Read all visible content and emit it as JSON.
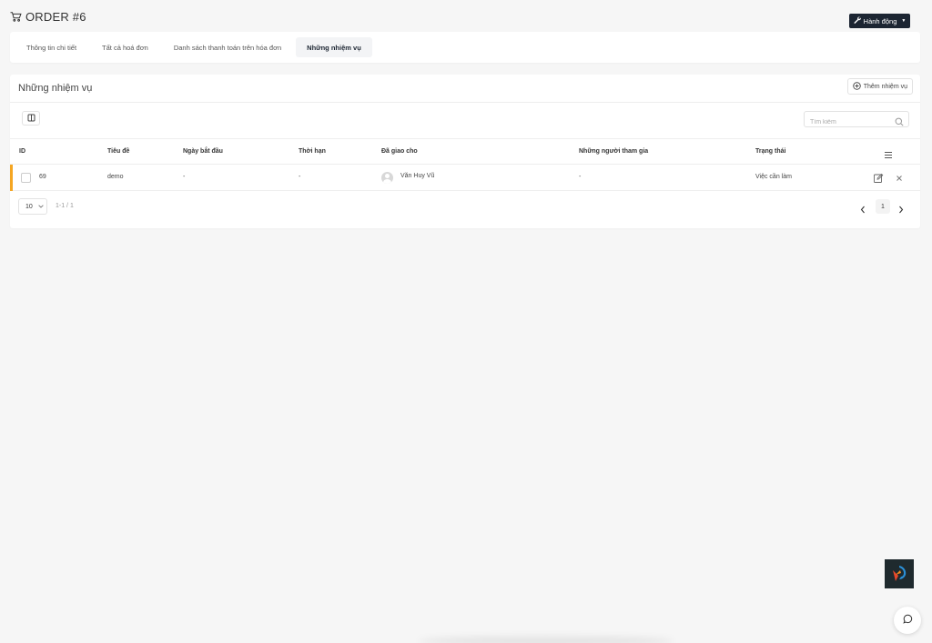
{
  "header": {
    "title": "ORDER #6",
    "icon": "cart-icon"
  },
  "action_button": {
    "label": "Hành động",
    "icon": "wrench-icon"
  },
  "tabs": [
    {
      "label": "Thông tin chi tiết",
      "active": false
    },
    {
      "label": "Tất cả hoá đơn",
      "active": false
    },
    {
      "label": "Danh sách thanh toán trên hóa đơn",
      "active": false
    },
    {
      "label": "Những nhiệm vụ",
      "active": true
    }
  ],
  "card": {
    "title": "Những nhiệm vụ",
    "add_button": "Thêm nhiệm vụ",
    "search_placeholder": "Tìm kiếm"
  },
  "table": {
    "columns": [
      "ID",
      "Tiêu đề",
      "Ngày bắt đầu",
      "Thời hạn",
      "Đã giao cho",
      "Những người tham gia",
      "Trạng thái"
    ],
    "rows": [
      {
        "id": "69",
        "title": "demo",
        "start": "-",
        "deadline": "-",
        "assignee": "Văn Huy Vũ",
        "participants": "-",
        "status": "Việc cần làm",
        "marker_color": "#f5a623"
      }
    ]
  },
  "pagination": {
    "page_size": "10",
    "info": "1-1 / 1",
    "current_page": "1"
  },
  "colors": {
    "primary": "#1c2532",
    "accent": "#f5a623"
  }
}
